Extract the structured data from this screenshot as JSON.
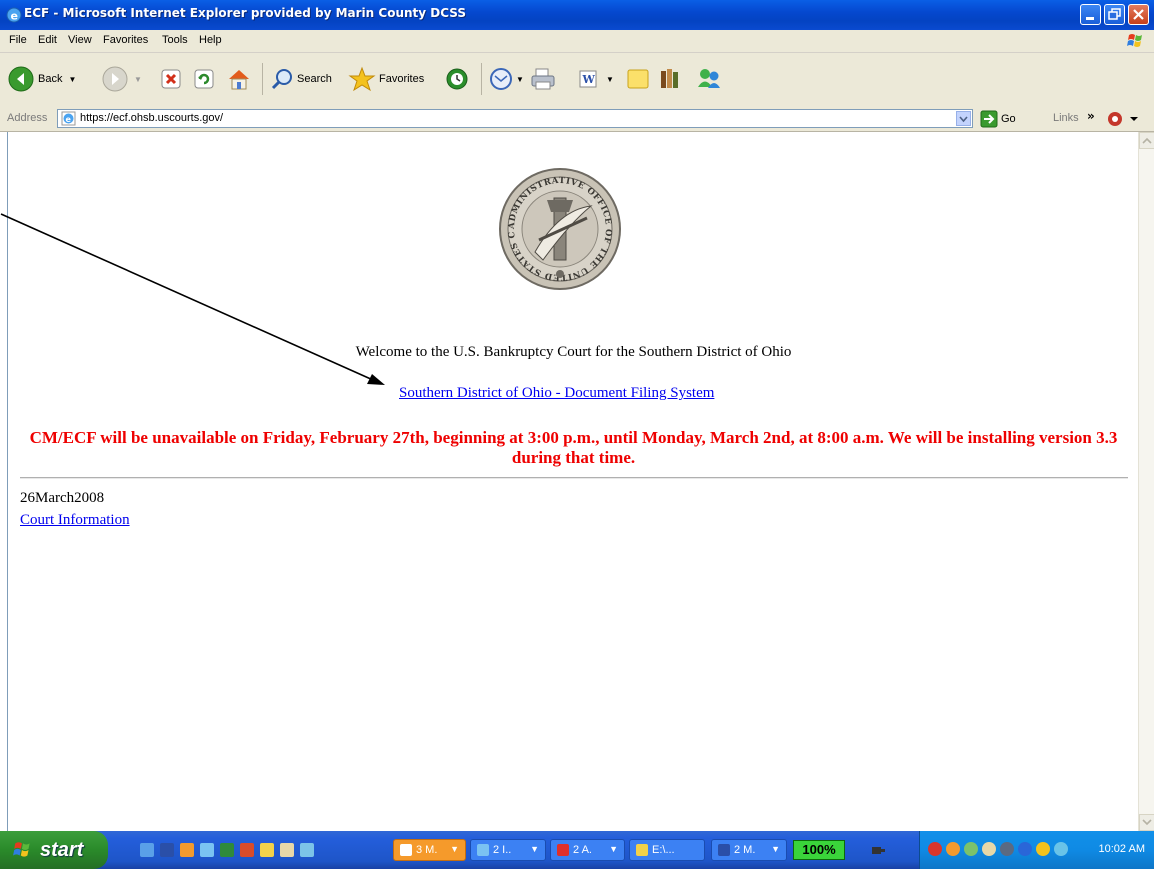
{
  "window": {
    "title": "ECF - Microsoft Internet Explorer provided by Marin County DCSS"
  },
  "menu": {
    "items": [
      "File",
      "Edit",
      "View",
      "Favorites",
      "Tools",
      "Help"
    ]
  },
  "toolbar": {
    "back_label": "Back",
    "search_label": "Search",
    "favorites_label": "Favorites"
  },
  "address": {
    "label": "Address",
    "url": "https://ecf.ohsb.uscourts.gov/",
    "go_label": "Go",
    "links_label": "Links"
  },
  "page": {
    "welcome": "Welcome to the U.S. Bankruptcy Court for the Southern District of Ohio",
    "filing_link": "Southern District of Ohio - Document Filing System",
    "notice": "CM/ECF will be unavailable on Friday, February 27th, beginning at 3:00 p.m., until Monday, March 2nd, at 8:00 a.m. We will be installing version 3.3 during that time.",
    "date": "26March2008",
    "court_info_link": "Court Information",
    "seal_text": "ADMINISTRATIVE OFFICE OF THE UNITED STATES COURTS"
  },
  "taskbar": {
    "start_label": "start",
    "tasks": [
      "3 M.",
      "2 I..",
      "2 A.",
      "E:\\...",
      "2 M."
    ],
    "zoom": "100%",
    "clock": "10:02 AM"
  },
  "colors": {
    "link": "#0000ee",
    "notice": "#ee0000",
    "titlebar": "#0548cf",
    "taskbar": "#245edb"
  }
}
